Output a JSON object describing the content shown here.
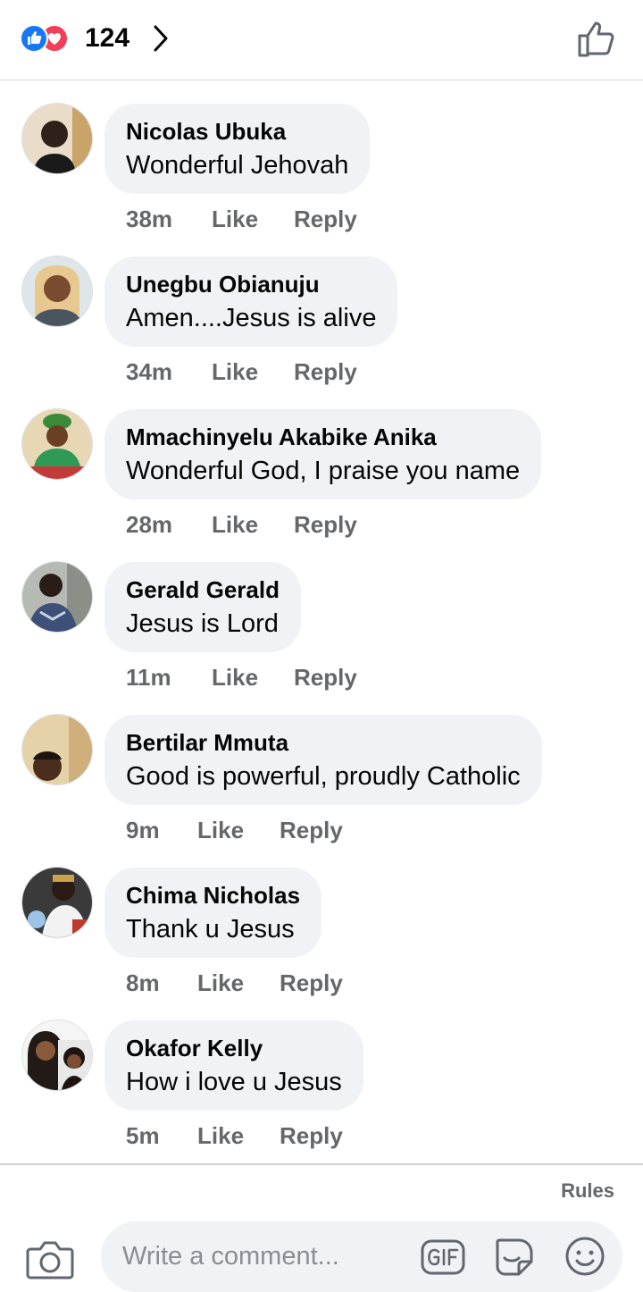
{
  "header": {
    "reaction_icons": [
      "like-reaction-icon",
      "love-reaction-icon"
    ],
    "reaction_count": "124",
    "chevron_icon": "chevron-right-icon",
    "like_button_icon": "thumbs-up-outline-icon"
  },
  "comments": [
    {
      "author": "Nicolas Ubuka",
      "text": "Wonderful Jehovah",
      "time": "38m",
      "like": "Like",
      "reply": "Reply"
    },
    {
      "author": "Unegbu Obianuju",
      "text": "Amen....Jesus is alive",
      "time": "34m",
      "like": "Like",
      "reply": "Reply"
    },
    {
      "author": "Mmachinyelu Akabike Anika",
      "text": "Wonderful God, I praise you name",
      "time": "28m",
      "like": "Like",
      "reply": "Reply"
    },
    {
      "author": "Gerald Gerald",
      "text": "Jesus is Lord",
      "time": "11m",
      "like": "Like",
      "reply": "Reply"
    },
    {
      "author": "Bertilar Mmuta",
      "text": "Good is powerful, proudly Catholic",
      "time": "9m",
      "like": "Like",
      "reply": "Reply"
    },
    {
      "author": "Chima Nicholas",
      "text": "Thank u Jesus",
      "time": "8m",
      "like": "Like",
      "reply": "Reply"
    },
    {
      "author": "Okafor Kelly",
      "text": "How i love u Jesus",
      "time": "5m",
      "like": "Like",
      "reply": "Reply"
    }
  ],
  "footer": {
    "rules_label": "Rules",
    "placeholder": "Write a comment...",
    "icons": [
      "camera-icon",
      "gif-icon",
      "sticker-icon",
      "emoji-icon"
    ]
  },
  "colors": {
    "like_blue": "#1877f2",
    "love_red": "#f33e58",
    "bubble_bg": "#f0f2f5",
    "meta_gray": "#65676b"
  }
}
